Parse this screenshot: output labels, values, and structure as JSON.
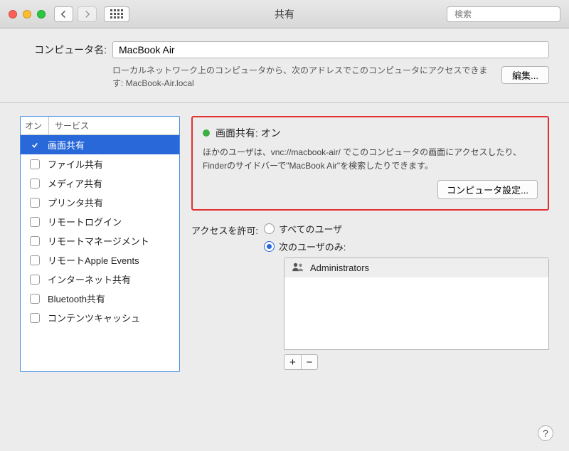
{
  "window": {
    "title": "共有",
    "search_placeholder": "検索"
  },
  "computer_name": {
    "label": "コンピュータ名:",
    "value": "MacBook Air",
    "description": "ローカルネットワーク上のコンピュータから、次のアドレスでこのコンピュータにアクセスできます: MacBook-Air.local",
    "edit_button": "編集..."
  },
  "services": {
    "header_on": "オン",
    "header_service": "サービス",
    "items": [
      {
        "name": "画面共有",
        "on": true,
        "selected": true
      },
      {
        "name": "ファイル共有",
        "on": false,
        "selected": false
      },
      {
        "name": "メディア共有",
        "on": false,
        "selected": false
      },
      {
        "name": "プリンタ共有",
        "on": false,
        "selected": false
      },
      {
        "name": "リモートログイン",
        "on": false,
        "selected": false
      },
      {
        "name": "リモートマネージメント",
        "on": false,
        "selected": false
      },
      {
        "name": "リモートApple Events",
        "on": false,
        "selected": false
      },
      {
        "name": "インターネット共有",
        "on": false,
        "selected": false
      },
      {
        "name": "Bluetooth共有",
        "on": false,
        "selected": false
      },
      {
        "name": "コンテンツキャッシュ",
        "on": false,
        "selected": false
      }
    ]
  },
  "status": {
    "title": "画面共有: オン",
    "description": "ほかのユーザは、vnc://macbook-air/ でこのコンピュータの画面にアクセスしたり、Finderのサイドバーで\"MacBook Air\"を検索したりできます。",
    "settings_button": "コンピュータ設定..."
  },
  "access": {
    "label": "アクセスを許可:",
    "option_all": "すべてのユーザ",
    "option_only": "次のユーザのみ:",
    "selected": "only",
    "users": [
      "Administrators"
    ]
  },
  "buttons": {
    "plus": "+",
    "minus": "−",
    "help": "?"
  }
}
